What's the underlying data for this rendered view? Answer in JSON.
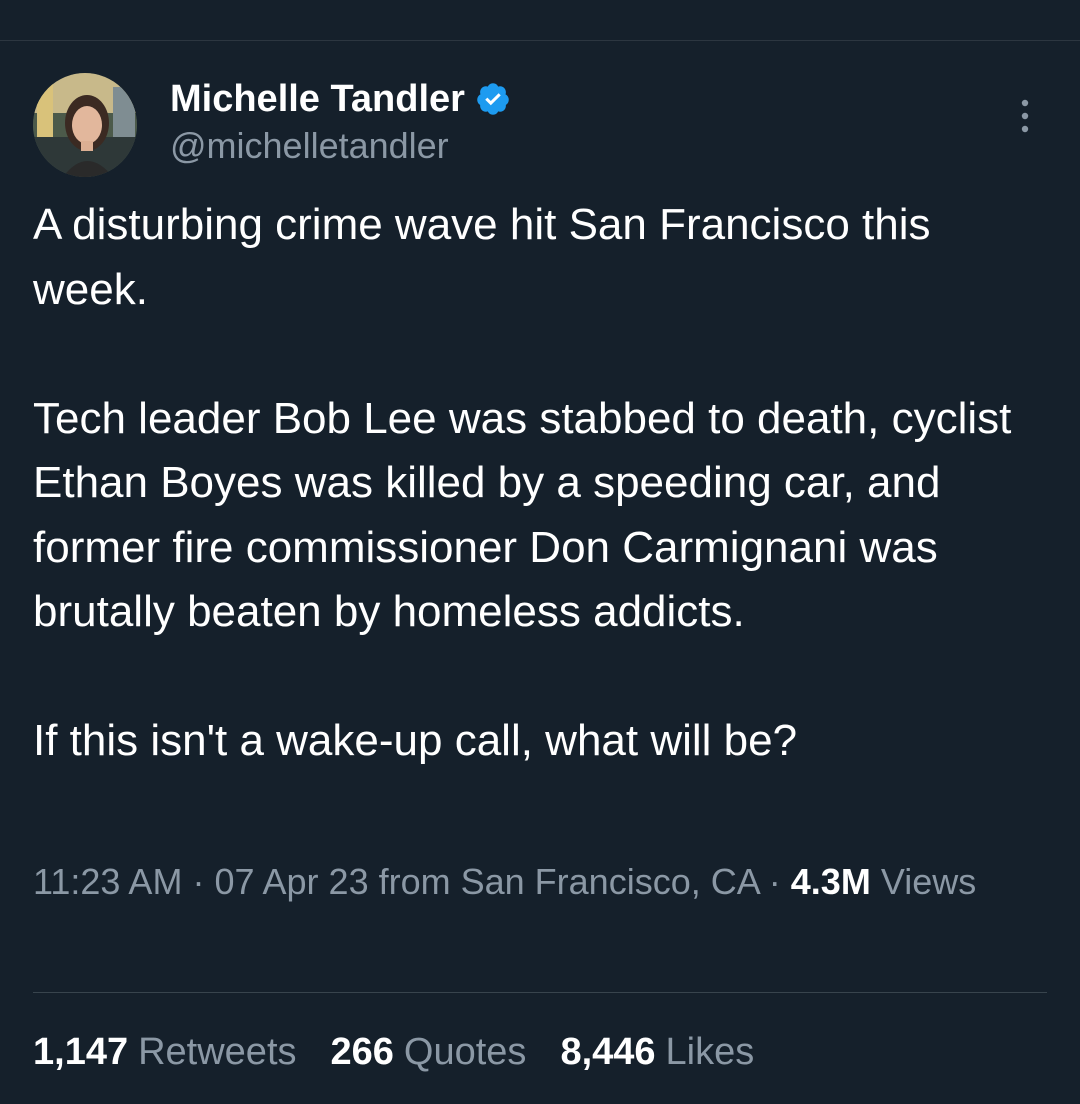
{
  "colors": {
    "background": "#15202b",
    "text_primary": "#ffffff",
    "text_secondary": "#8b98a5",
    "verified_blue": "#1d9bf0",
    "divider": "#38444d"
  },
  "author": {
    "display_name": "Michelle Tandler",
    "handle": "@michelletandler",
    "verified": true,
    "verified_icon": "verified-badge-icon",
    "avatar_icon": "avatar"
  },
  "menu": {
    "icon": "more-vertical-icon"
  },
  "tweet": {
    "text": "A disturbing crime wave hit San Francisco this week.\n\nTech leader Bob Lee was stabbed to death, cyclist Ethan Boyes was killed by a speeding car, and former fire commissioner Don Carmignani was brutally beaten by homeless addicts.\n\nIf this isn't a wake-up call, what will be?"
  },
  "meta": {
    "time": "11:23 AM",
    "date": "07 Apr 23",
    "location": "from San Francisco, CA",
    "separator": "·",
    "views_count": "4.3M",
    "views_label": "Views"
  },
  "stats": {
    "retweets_count": "1,147",
    "retweets_label": "Retweets",
    "quotes_count": "266",
    "quotes_label": "Quotes",
    "likes_count": "8,446",
    "likes_label": "Likes"
  }
}
